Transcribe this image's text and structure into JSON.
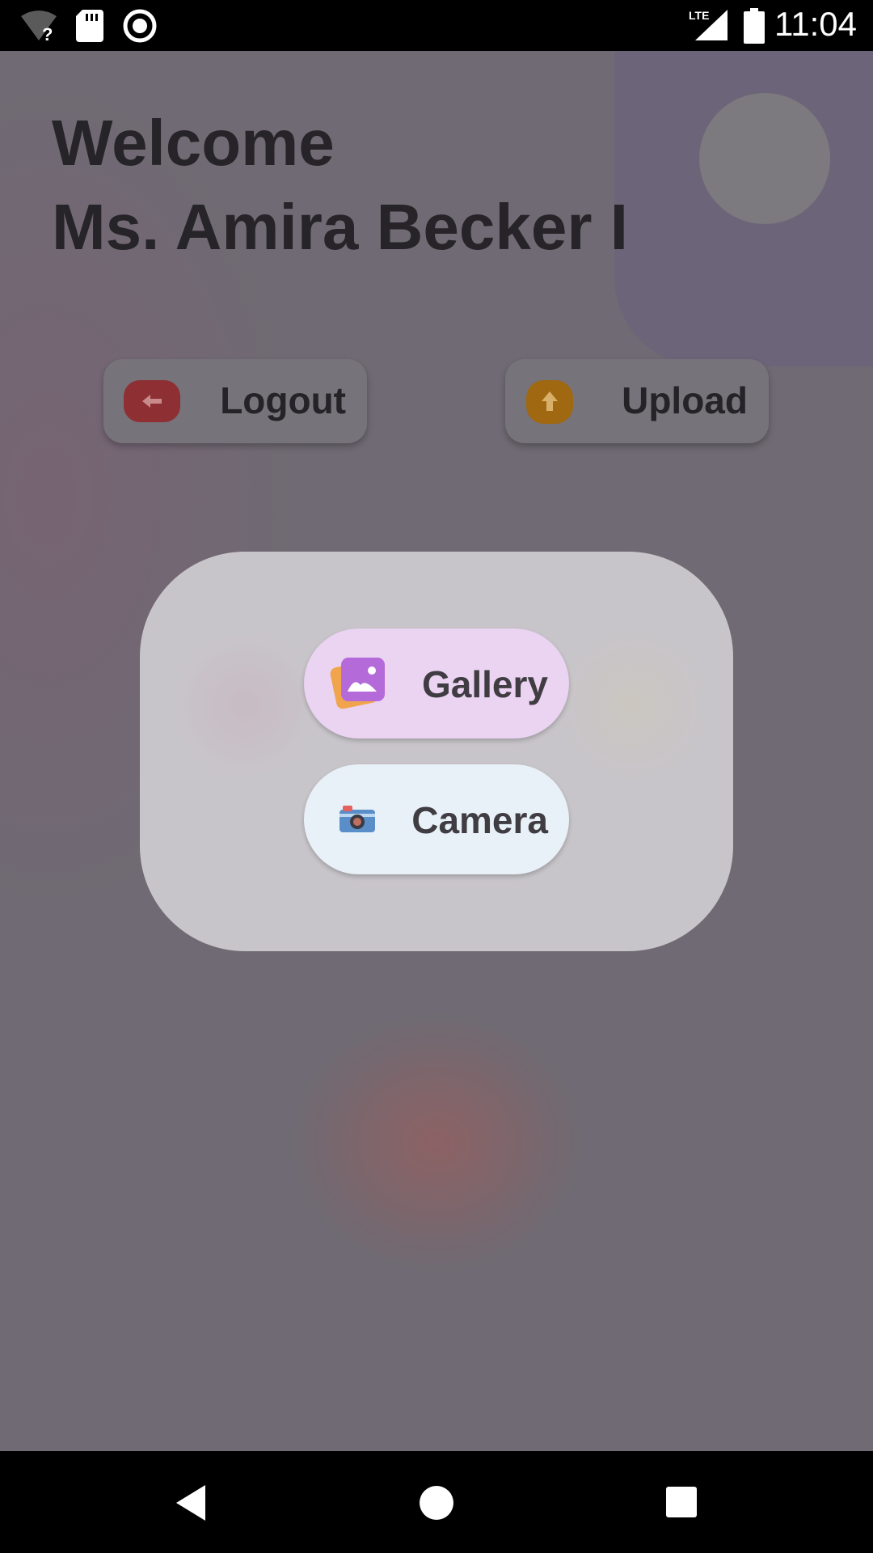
{
  "status_bar": {
    "time": "11:04",
    "network_label": "LTE",
    "icons": [
      "wifi-unknown-icon",
      "sd-card-icon",
      "record-icon",
      "lte-signal-icon",
      "battery-icon"
    ]
  },
  "header": {
    "welcome_line": "Welcome",
    "user_name": "Ms. Amira Becker I"
  },
  "actions": {
    "logout_label": "Logout",
    "upload_label": "Upload"
  },
  "picker": {
    "gallery_label": "Gallery",
    "camera_label": "Camera"
  },
  "nav": {
    "icons": [
      "back-icon",
      "home-icon",
      "recents-icon"
    ]
  },
  "colors": {
    "logout_accent": "#8e2f34",
    "upload_accent": "#a06810",
    "gallery_bg": "#ebd3f2",
    "camera_bg": "#e8f1f8"
  }
}
